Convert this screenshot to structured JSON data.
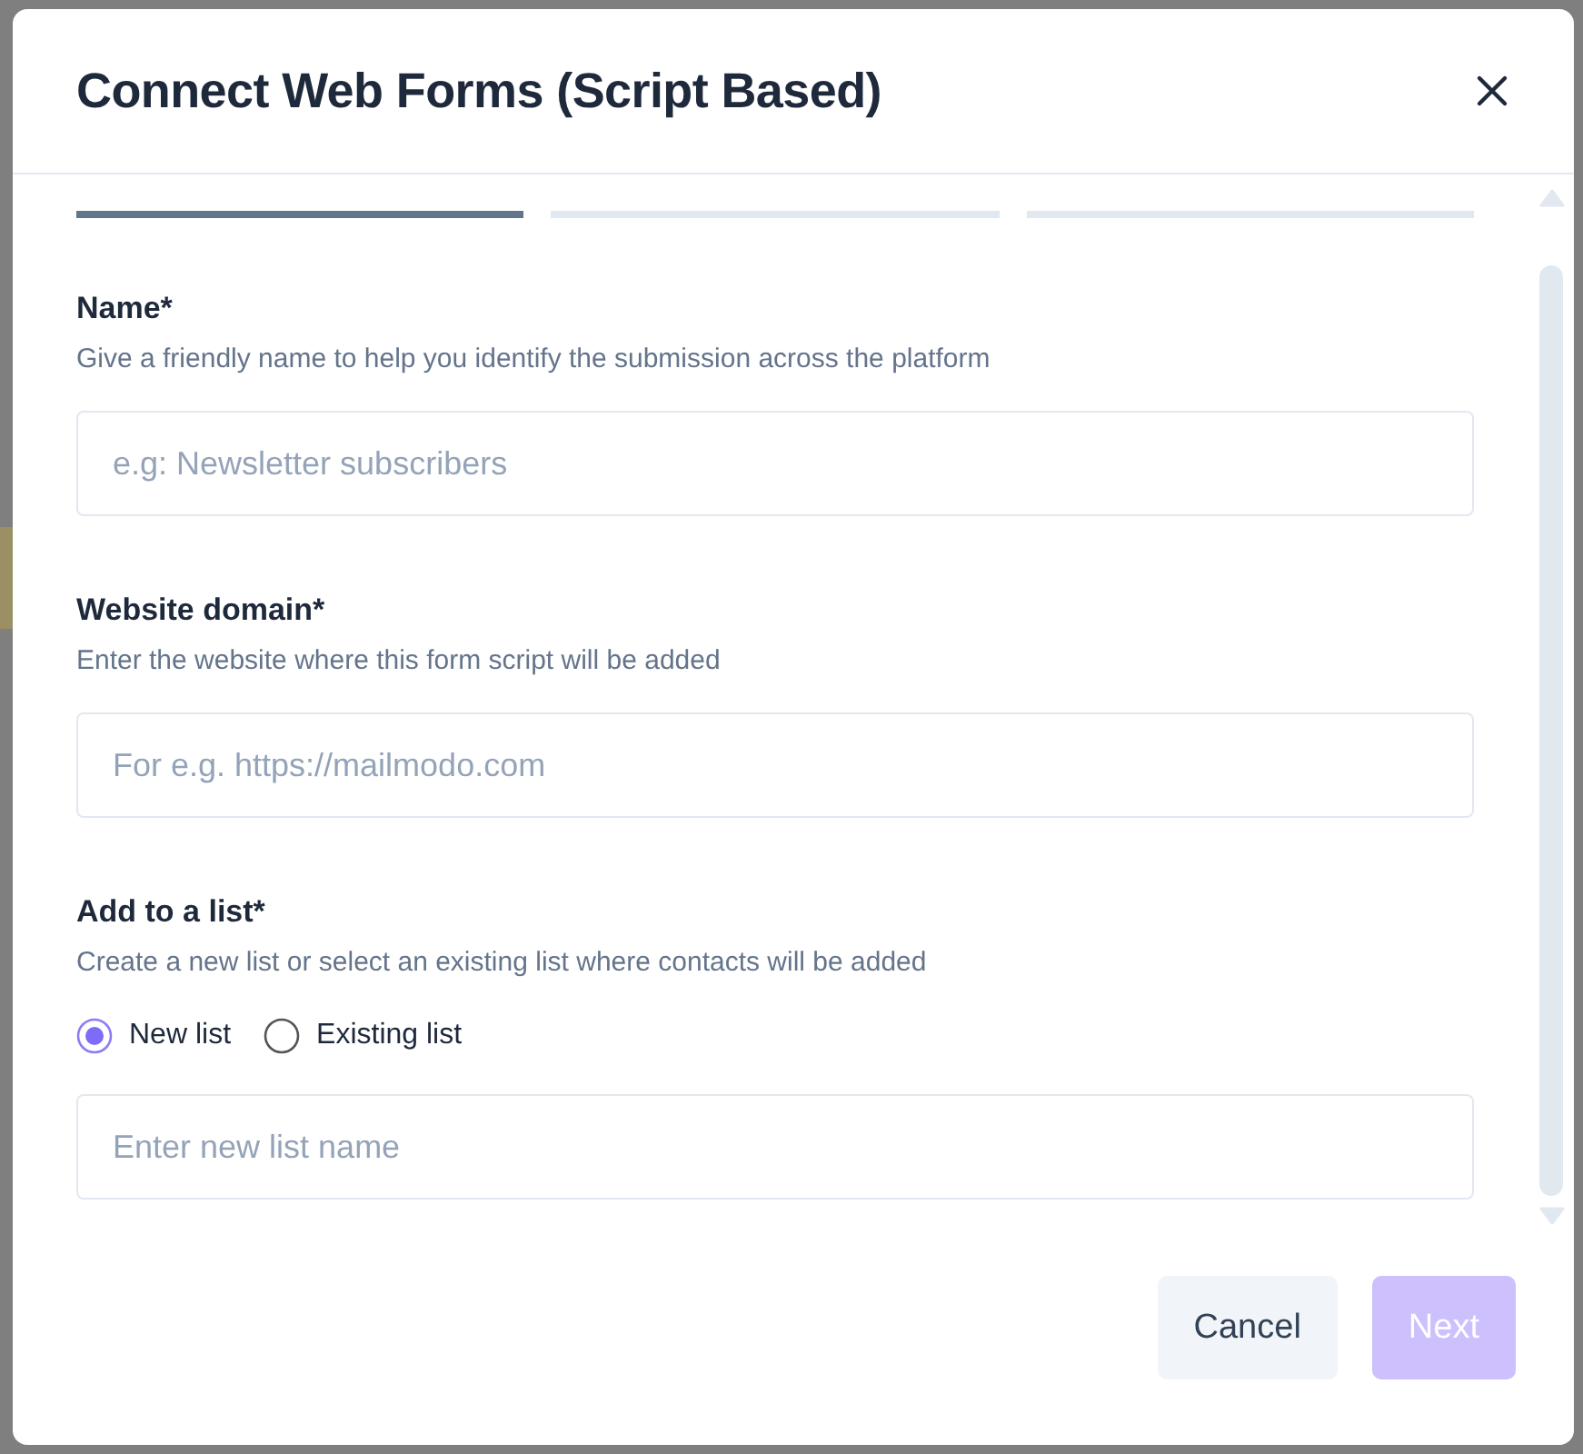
{
  "dialog": {
    "title": "Connect Web Forms (Script Based)"
  },
  "steps": [
    {
      "complete": true
    },
    {
      "complete": false
    },
    {
      "complete": false
    }
  ],
  "fields": [
    {
      "kind": "text",
      "label": "Name*",
      "description": "Give a friendly name to help you identify the submission across the platform",
      "placeholder": "e.g: Newsletter subscribers"
    },
    {
      "kind": "text",
      "label": "Website domain*",
      "description": "Enter the website where this form script will be added",
      "placeholder": "For e.g. https://mailmodo.com"
    },
    {
      "kind": "radio-text",
      "label": "Add to a list*",
      "description": "Create a new list or select an existing list where contacts will be added",
      "options": [
        {
          "label": "New list",
          "selected": true
        },
        {
          "label": "Existing list",
          "selected": false
        }
      ],
      "placeholder": "Enter new list name"
    }
  ],
  "buttons": [
    {
      "label": "Cancel",
      "kind": "secondary",
      "disabled": false
    },
    {
      "label": "Next",
      "kind": "primary",
      "disabled": true
    }
  ]
}
